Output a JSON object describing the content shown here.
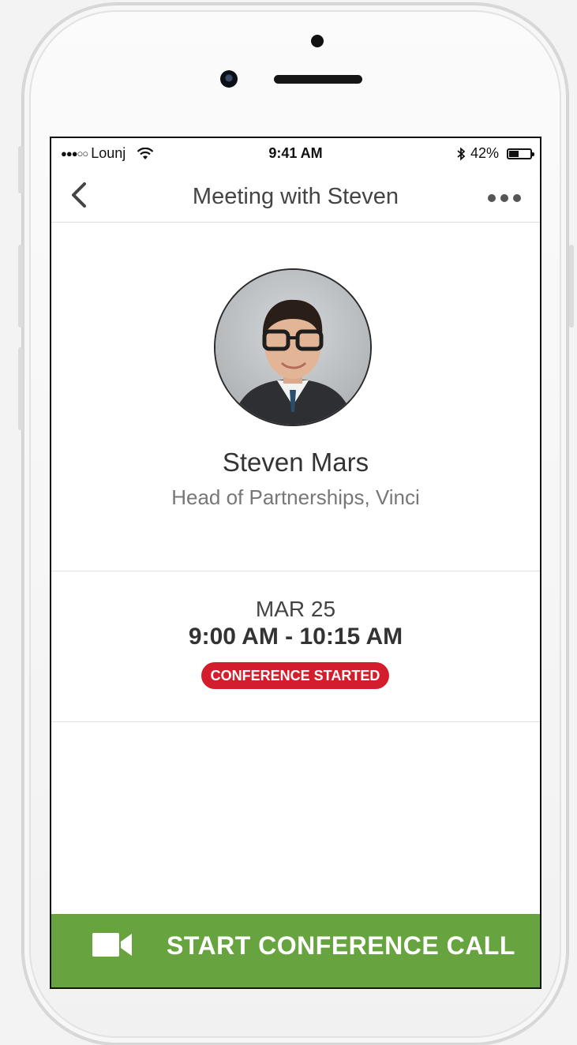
{
  "status_bar": {
    "carrier": "Lounj",
    "signal_dots": "●●●○○",
    "time": "9:41 AM",
    "bluetooth_icon": "bluetooth-icon",
    "battery": "42%"
  },
  "nav": {
    "title": "Meeting with Steven",
    "back_icon": "chevron-left-icon",
    "more_icon": "more-horizontal-icon"
  },
  "contact": {
    "name": "Steven Mars",
    "role": "Head of Partnerships, Vinci"
  },
  "meeting": {
    "date": "MAR 25",
    "time_range": "9:00 AM - 10:15 AM",
    "status": "CONFERENCE STARTED",
    "status_color": "#d41d2c"
  },
  "cta": {
    "label": "START CONFERENCE CALL",
    "icon": "video-camera-icon",
    "color": "#67a33e"
  }
}
